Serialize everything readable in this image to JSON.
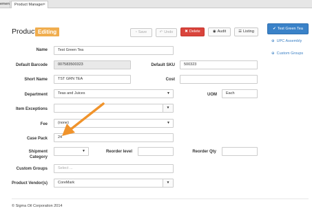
{
  "tabs": {
    "previous": "ement",
    "active": "Product Manager",
    "close": "×"
  },
  "header": {
    "title": "Product",
    "mode_badge": "Editing"
  },
  "toolbar": {
    "save_label": "Save",
    "undo_label": "Undo",
    "delete_label": "Delete",
    "audit_label": "Audit",
    "listing_label": "Listing",
    "primary_label": "Test Green Tea"
  },
  "side_links": {
    "upc_assembly": "UPC Assembly",
    "custom_groups": "Custom Groups"
  },
  "form": {
    "name": {
      "label": "Name",
      "value": "Test Green Tea"
    },
    "default_barcode": {
      "label": "Default Barcode",
      "value": "007583500323"
    },
    "default_sku": {
      "label": "Default SKU",
      "value": "500323"
    },
    "short_name": {
      "label": "Short Name",
      "value": "TST GRN TEA"
    },
    "cost": {
      "label": "Cost",
      "value": ""
    },
    "department": {
      "label": "Department",
      "value": "Teas and Juices"
    },
    "uom": {
      "label": "UOM",
      "value": "Each"
    },
    "item_exceptions": {
      "label": "Item Exceptions",
      "value": ""
    },
    "fee": {
      "label": "Fee",
      "value": "(none)"
    },
    "case_pack": {
      "label": "Case Pack",
      "value": "24"
    },
    "shipment_category": {
      "label_line1": "Shipment",
      "label_line2": "Category",
      "value": ""
    },
    "reorder_level": {
      "label": "Reorder level",
      "value": ""
    },
    "reorder_qty": {
      "label": "Reorder Qty",
      "value": ""
    },
    "custom_groups": {
      "label": "Custom Groups",
      "placeholder": "Select ..."
    },
    "product_vendors": {
      "label": "Product Vendor(s)",
      "value": "CoreMark"
    }
  },
  "footer": {
    "copyright": "© Sigma Oil Corporation 2014"
  },
  "colors": {
    "accent_blue": "#3a82c8",
    "badge_orange": "#f0ad4e",
    "delete_red": "#d9443c",
    "annotation_arrow": "#f0932b"
  }
}
